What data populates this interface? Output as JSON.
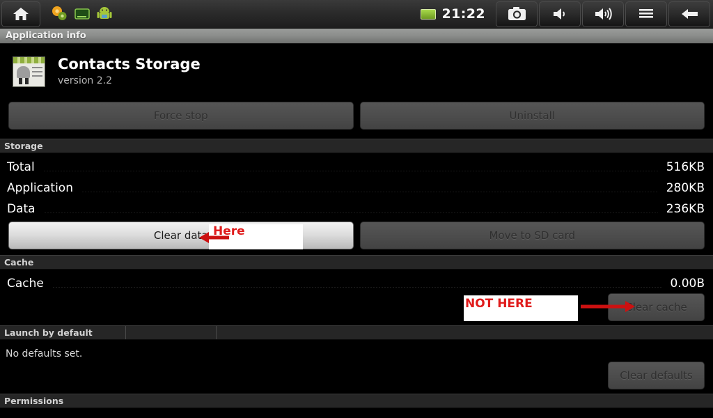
{
  "statusbar": {
    "home_icon": "home-icon",
    "tray_icons": [
      "settings-gears-icon",
      "terminal-screen-icon",
      "android-robot-icon"
    ],
    "battery_icon": "battery-icon",
    "time": "21:22",
    "buttons": [
      {
        "name": "screenshot-button",
        "icon": "camera-icon"
      },
      {
        "name": "volume-down-button",
        "icon": "volume-low-icon"
      },
      {
        "name": "volume-up-button",
        "icon": "volume-high-icon"
      },
      {
        "name": "menu-button",
        "icon": "hamburger-menu-icon"
      },
      {
        "name": "back-button",
        "icon": "arrow-left-icon"
      }
    ]
  },
  "titlebar": {
    "title": "Application info"
  },
  "app": {
    "name": "Contacts Storage",
    "version": "version 2.2",
    "icon": "android-app-icon"
  },
  "actions": {
    "force_stop": "Force stop",
    "uninstall": "Uninstall"
  },
  "storage": {
    "header": "Storage",
    "rows": [
      {
        "label": "Total",
        "value": "516KB"
      },
      {
        "label": "Application",
        "value": "280KB"
      },
      {
        "label": "Data",
        "value": "236KB"
      }
    ],
    "clear_data": "Clear data",
    "move_to_sd": "Move to SD card"
  },
  "cache": {
    "header": "Cache",
    "rows": [
      {
        "label": "Cache",
        "value": "0.00B"
      }
    ],
    "clear_cache": "Clear cache"
  },
  "launch_by_default": {
    "header": "Launch by default",
    "status": "No defaults set.",
    "clear_defaults": "Clear defaults"
  },
  "permissions": {
    "header": "Permissions"
  },
  "annotations": {
    "here": "Here",
    "not_here": "NOT HERE",
    "color": "#e01b1b"
  }
}
